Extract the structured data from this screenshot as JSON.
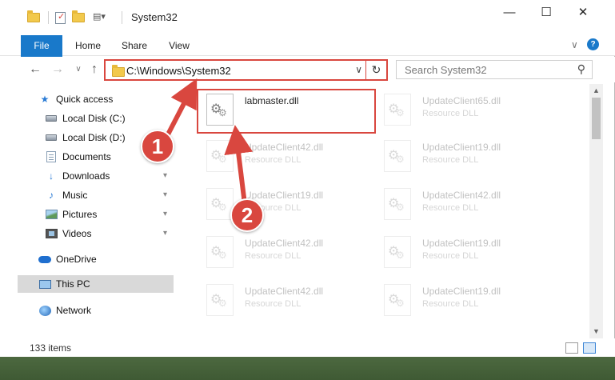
{
  "window": {
    "title": "System32",
    "controls": {
      "minimize": "—",
      "maximize": "☐",
      "close": "✕"
    }
  },
  "ribbon": {
    "tabs": [
      "File",
      "Home",
      "Share",
      "View"
    ],
    "collapse_glyph": "∨",
    "help_glyph": "?"
  },
  "nav": {
    "back": "←",
    "forward": "→",
    "recent": "∨",
    "up": "↑",
    "address_path": "C:\\Windows\\System32",
    "address_dropdown": "∨",
    "refresh": "↻",
    "search_placeholder": "Search System32",
    "search_glyph": "⚲"
  },
  "sidebar": {
    "items": [
      {
        "label": "Quick access",
        "icon": "star-icon",
        "pinned": false
      },
      {
        "label": "Local Disk (C:)",
        "icon": "drive-icon",
        "pinned": false
      },
      {
        "label": "Local Disk (D:)",
        "icon": "drive-icon",
        "pinned": false
      },
      {
        "label": "Documents",
        "icon": "documents-icon",
        "pinned": true
      },
      {
        "label": "Downloads",
        "icon": "download-icon",
        "pinned": true
      },
      {
        "label": "Music",
        "icon": "music-icon",
        "pinned": true
      },
      {
        "label": "Pictures",
        "icon": "pictures-icon",
        "pinned": true
      },
      {
        "label": "Videos",
        "icon": "videos-icon",
        "pinned": true
      },
      {
        "label": "OneDrive",
        "icon": "onedrive-icon",
        "pinned": false
      },
      {
        "label": "This PC",
        "icon": "this-pc-icon",
        "pinned": false,
        "selected": true
      },
      {
        "label": "Network",
        "icon": "network-icon",
        "pinned": false
      }
    ],
    "pin_glyph": "📌",
    "drive_glyph": "",
    "star_glyph": "★",
    "download_glyph": "↓",
    "music_glyph": "♪"
  },
  "files": [
    {
      "name": "labmaster.dll",
      "type": "",
      "highlighted": true
    },
    {
      "name": "UpdateClient65.dll",
      "type": "Resource DLL"
    },
    {
      "name": "UpdateClient42.dll",
      "type": "Resource DLL"
    },
    {
      "name": "UpdateClient19.dll",
      "type": "Resource DLL"
    },
    {
      "name": "UpdateClient19.dll",
      "type": "Resource DLL"
    },
    {
      "name": "UpdateClient42.dll",
      "type": "Resource DLL"
    },
    {
      "name": "UpdateClient42.dll",
      "type": "Resource DLL"
    },
    {
      "name": "UpdateClient19.dll",
      "type": "Resource DLL"
    },
    {
      "name": "UpdateClient42.dll",
      "type": "Resource DLL"
    },
    {
      "name": "UpdateClient19.dll",
      "type": "Resource DLL"
    }
  ],
  "status": {
    "item_count": "133 items"
  },
  "scrollbar": {
    "up": "▲",
    "down": "▼"
  },
  "callouts": [
    {
      "number": "1"
    },
    {
      "number": "2"
    }
  ],
  "colors": {
    "accent": "#1979ca",
    "callout": "#d9473f"
  }
}
